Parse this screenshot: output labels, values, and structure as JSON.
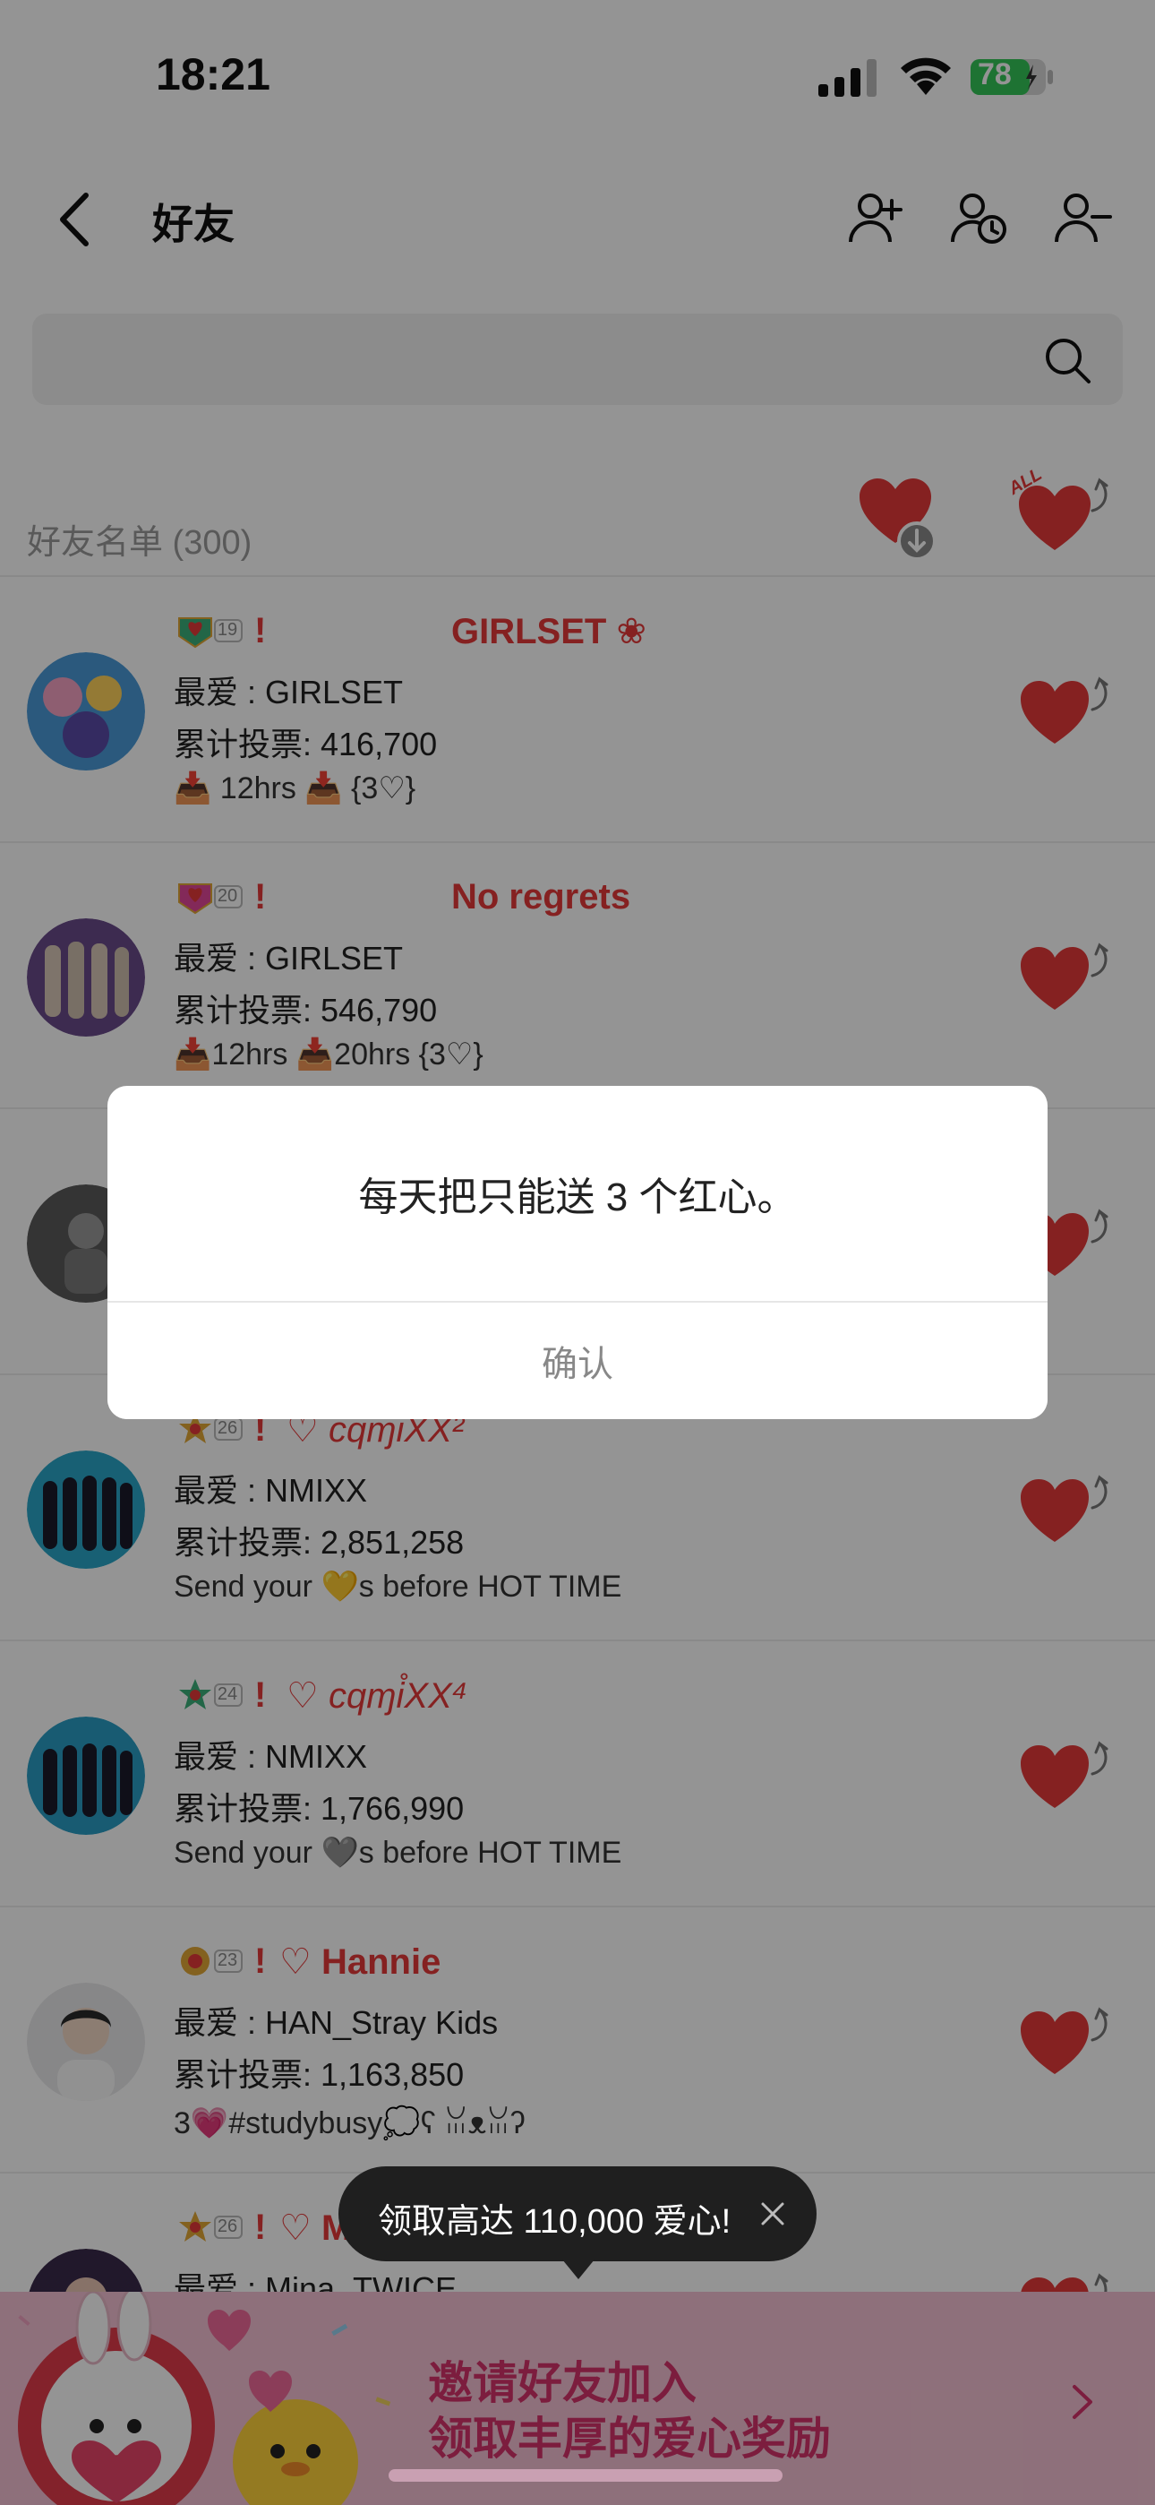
{
  "status_bar": {
    "time": "18:21",
    "battery": "78"
  },
  "header": {
    "title": "好友"
  },
  "search": {
    "placeholder": ""
  },
  "list_header": {
    "label": "好友名单 (300)"
  },
  "friends": [
    {
      "level": "19",
      "bang": "!",
      "nick": "GIRLSET ❀",
      "favorite": "最爱 : GIRLSET",
      "votes": "累计投票: 416,700",
      "extra": "📥 12hrs  📥  {3♡}"
    },
    {
      "level": "20",
      "bang": "!",
      "nick": "No regrets",
      "favorite": "最爱 : GIRLSET",
      "votes": "累计投票: 546,790",
      "extra": "📥12hrs  📥20hrs  {3♡}"
    },
    {
      "level": "",
      "bang": "",
      "nick": "",
      "favorite": "",
      "votes": "",
      "extra": ""
    },
    {
      "level": "26",
      "bang": "!",
      "nick": "♡ cqɱi̊XX²",
      "favorite": "最爱 : NMIXX",
      "votes": "累计投票: 2,851,258",
      "extra": "Send your 💛s before HOT TIME"
    },
    {
      "level": "24",
      "bang": "!",
      "nick": "♡ cqɱi̊XX⁴",
      "favorite": "最爱 : NMIXX",
      "votes": "累计投票: 1,766,990",
      "extra": "Send your 🩶s before HOT TIME"
    },
    {
      "level": "23",
      "bang": "!",
      "nick": "♡ Hannie",
      "favorite": "最爱 : HAN_Stray Kids",
      "votes": "累计投票: 1,163,850",
      "extra": "3💗#studybusy💭ʕ ꈍᴥꈍʔ"
    },
    {
      "level": "26",
      "bang": "!",
      "nick": "♡ M",
      "favorite": "最爱 : Mina_TWICE",
      "votes": "",
      "extra": ""
    }
  ],
  "dialog": {
    "message": "每天把只能送 3 个红心。",
    "confirm": "确认"
  },
  "tooltip": {
    "text": "领取高达 110,000 爱心!"
  },
  "banner": {
    "line1": "邀请好友加入",
    "line2": "领取丰厚的爱心奖励"
  },
  "colors": {
    "accent": "#e53939",
    "banner_bg": "#f4c2d4",
    "banner_text": "#d6336c"
  }
}
